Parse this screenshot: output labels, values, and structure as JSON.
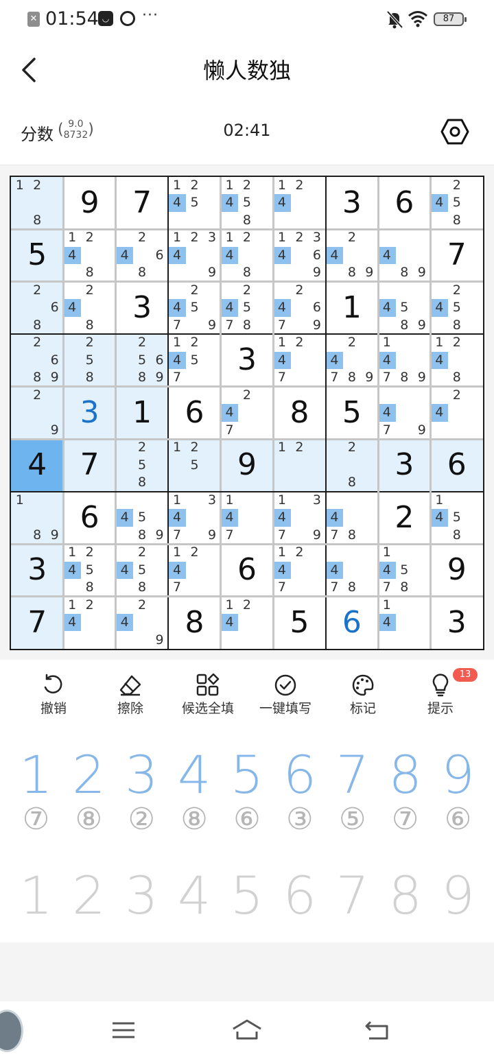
{
  "status_bar": {
    "time": "01:54",
    "notification_icon": "x-square-icon",
    "msg_icon": "message-icon",
    "app_icon": "search-app-icon",
    "more": "···",
    "battery": "87"
  },
  "header": {
    "title": "懒人数独"
  },
  "info": {
    "score_label": "分数",
    "score_value": "9.0",
    "score_total": "8732",
    "timer": "02:41"
  },
  "board": {
    "selected": [
      5,
      0
    ],
    "highlight_color": "#e3f1fd",
    "selected_color": "#6eb4ef",
    "mark_color": "#8fc1ee",
    "user_color": "#1a73c8",
    "cells": [
      [
        {
          "c": [
            1,
            2,
            8
          ]
        },
        {
          "v": "9"
        },
        {
          "v": "7"
        },
        {
          "c": [
            1,
            2,
            4,
            5
          ],
          "m": 4
        },
        {
          "c": [
            1,
            2,
            4,
            5,
            8
          ],
          "m": 4
        },
        {
          "c": [
            1,
            2,
            4
          ],
          "m": 4
        },
        {
          "v": "3"
        },
        {
          "v": "6"
        },
        {
          "c": [
            2,
            4,
            5,
            8
          ],
          "m": 4
        }
      ],
      [
        {
          "v": "5"
        },
        {
          "c": [
            1,
            2,
            4,
            8
          ],
          "m": 4
        },
        {
          "c": [
            2,
            4,
            6,
            8
          ],
          "m": 4
        },
        {
          "c": [
            1,
            2,
            3,
            4,
            9
          ],
          "m": 4
        },
        {
          "c": [
            1,
            2,
            4,
            8
          ],
          "m": 4
        },
        {
          "c": [
            1,
            2,
            3,
            4,
            6,
            9
          ],
          "m": 4
        },
        {
          "c": [
            2,
            4,
            8,
            9
          ],
          "m": 4
        },
        {
          "c": [
            4,
            8,
            9
          ],
          "m": 4
        },
        {
          "v": "7"
        }
      ],
      [
        {
          "c": [
            2,
            6,
            8
          ]
        },
        {
          "c": [
            2,
            4,
            8
          ],
          "m": 4
        },
        {
          "v": "3"
        },
        {
          "c": [
            2,
            4,
            5,
            7,
            9
          ],
          "m": 4
        },
        {
          "c": [
            2,
            4,
            5,
            7,
            8
          ],
          "m": 4
        },
        {
          "c": [
            2,
            4,
            6,
            7,
            9
          ],
          "m": 4
        },
        {
          "v": "1"
        },
        {
          "c": [
            4,
            5,
            8,
            9
          ],
          "m": 4
        },
        {
          "c": [
            2,
            4,
            5,
            8
          ],
          "m": 4
        }
      ],
      [
        {
          "c": [
            2,
            6,
            8,
            9
          ]
        },
        {
          "c": [
            2,
            5,
            8
          ]
        },
        {
          "c": [
            2,
            5,
            6,
            8,
            9
          ]
        },
        {
          "c": [
            1,
            2,
            4,
            5,
            7
          ],
          "m": 4
        },
        {
          "v": "3"
        },
        {
          "c": [
            1,
            2,
            4,
            7
          ],
          "m": 4
        },
        {
          "c": [
            2,
            4,
            7,
            8,
            9
          ],
          "m": 4
        },
        {
          "c": [
            1,
            4,
            7,
            8,
            9
          ],
          "m": 4
        },
        {
          "c": [
            1,
            2,
            4,
            8
          ],
          "m": 4
        }
      ],
      [
        {
          "c": [
            2,
            9
          ]
        },
        {
          "v": "3",
          "u": true
        },
        {
          "v": "1"
        },
        {
          "v": "6"
        },
        {
          "c": [
            2,
            4,
            7
          ],
          "m": 4
        },
        {
          "v": "8"
        },
        {
          "v": "5"
        },
        {
          "c": [
            4,
            7,
            9
          ],
          "m": 4
        },
        {
          "c": [
            2,
            4
          ],
          "m": 4
        }
      ],
      [
        {
          "v": "4"
        },
        {
          "v": "7"
        },
        {
          "c": [
            2,
            5,
            8
          ]
        },
        {
          "c": [
            1,
            2,
            5
          ]
        },
        {
          "v": "9"
        },
        {
          "c": [
            1,
            2
          ]
        },
        {
          "c": [
            2,
            8
          ]
        },
        {
          "v": "3"
        },
        {
          "v": "6"
        }
      ],
      [
        {
          "c": [
            1,
            8,
            9
          ]
        },
        {
          "v": "6"
        },
        {
          "c": [
            4,
            5,
            8,
            9
          ],
          "m": 4
        },
        {
          "c": [
            1,
            3,
            4,
            7,
            9
          ],
          "m": 4
        },
        {
          "c": [
            1,
            4,
            7
          ],
          "m": 4
        },
        {
          "c": [
            1,
            3,
            4,
            7,
            9
          ],
          "m": 4
        },
        {
          "c": [
            4,
            7,
            8
          ],
          "m": 4
        },
        {
          "v": "2"
        },
        {
          "c": [
            1,
            4,
            5,
            8
          ],
          "m": 4
        }
      ],
      [
        {
          "v": "3"
        },
        {
          "c": [
            1,
            2,
            4,
            5,
            8
          ],
          "m": 4
        },
        {
          "c": [
            2,
            4,
            5,
            8
          ],
          "m": 4
        },
        {
          "c": [
            1,
            2,
            4,
            7
          ],
          "m": 4
        },
        {
          "v": "6"
        },
        {
          "c": [
            1,
            2,
            4,
            7
          ],
          "m": 4
        },
        {
          "c": [
            4,
            7,
            8
          ],
          "m": 4
        },
        {
          "c": [
            1,
            4,
            5,
            7,
            8
          ],
          "m": 4
        },
        {
          "v": "9"
        }
      ],
      [
        {
          "v": "7"
        },
        {
          "c": [
            1,
            2,
            4
          ],
          "m": 4
        },
        {
          "c": [
            2,
            4,
            9
          ],
          "m": 4
        },
        {
          "v": "8"
        },
        {
          "c": [
            1,
            2,
            4
          ],
          "m": 4
        },
        {
          "v": "5"
        },
        {
          "v": "6",
          "u": true
        },
        {
          "c": [
            1,
            4
          ],
          "m": 4
        },
        {
          "v": "3"
        }
      ]
    ]
  },
  "toolbar": {
    "undo": "撤销",
    "erase": "擦除",
    "fill_candidates": "候选全填",
    "auto_fill": "一键填写",
    "mark": "标记",
    "hint": "提示",
    "hint_badge": "13"
  },
  "number_pad": {
    "digits": [
      "1",
      "2",
      "3",
      "4",
      "5",
      "6",
      "7",
      "8",
      "9"
    ],
    "remaining": [
      "⑦",
      "⑧",
      "②",
      "⑧",
      "⑥",
      "③",
      "⑤",
      "⑦",
      "⑥"
    ]
  },
  "note_pad": {
    "digits": [
      "1",
      "2",
      "3",
      "4",
      "5",
      "6",
      "7",
      "8",
      "9"
    ]
  },
  "nav": {
    "menu": "menu-icon",
    "home": "home-icon",
    "back": "back-icon"
  }
}
